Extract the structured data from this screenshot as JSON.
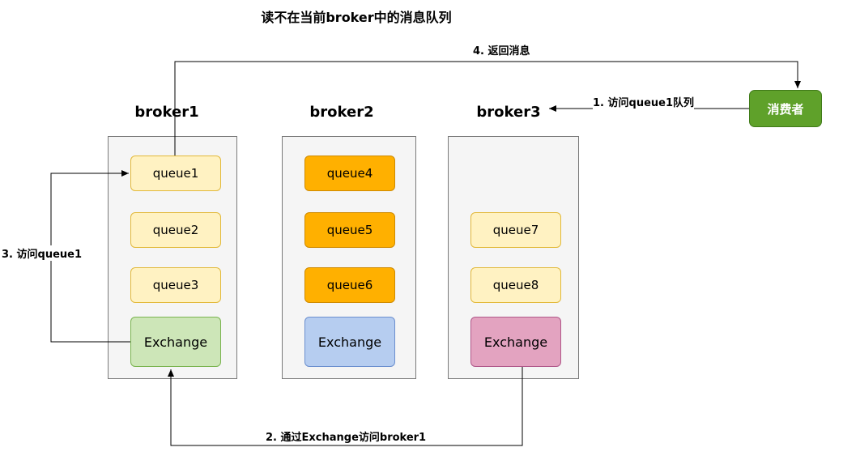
{
  "title": "读不在当前broker中的消息队列",
  "brokers": [
    {
      "label": "broker1",
      "queues": [
        "queue1",
        "queue2",
        "queue3"
      ],
      "exchange": "Exchange"
    },
    {
      "label": "broker2",
      "queues": [
        "queue4",
        "queue5",
        "queue6"
      ],
      "exchange": "Exchange"
    },
    {
      "label": "broker3",
      "queues": [
        "queue7",
        "queue8"
      ],
      "exchange": "Exchange"
    }
  ],
  "consumer": "消费者",
  "edges": {
    "step1": "1. 访问queue1队列",
    "step2": "2. 通过Exchange访问broker1",
    "step3": "3. 访问queue1",
    "step4": "4. 返回消息"
  },
  "colors": {
    "queue_light": "#fff2c2",
    "queue_orange": "#ffb000",
    "exchange_green": "#cde6b8",
    "exchange_blue": "#b6cdf0",
    "exchange_pink": "#e3a3c0",
    "consumer": "#5fa12a"
  }
}
